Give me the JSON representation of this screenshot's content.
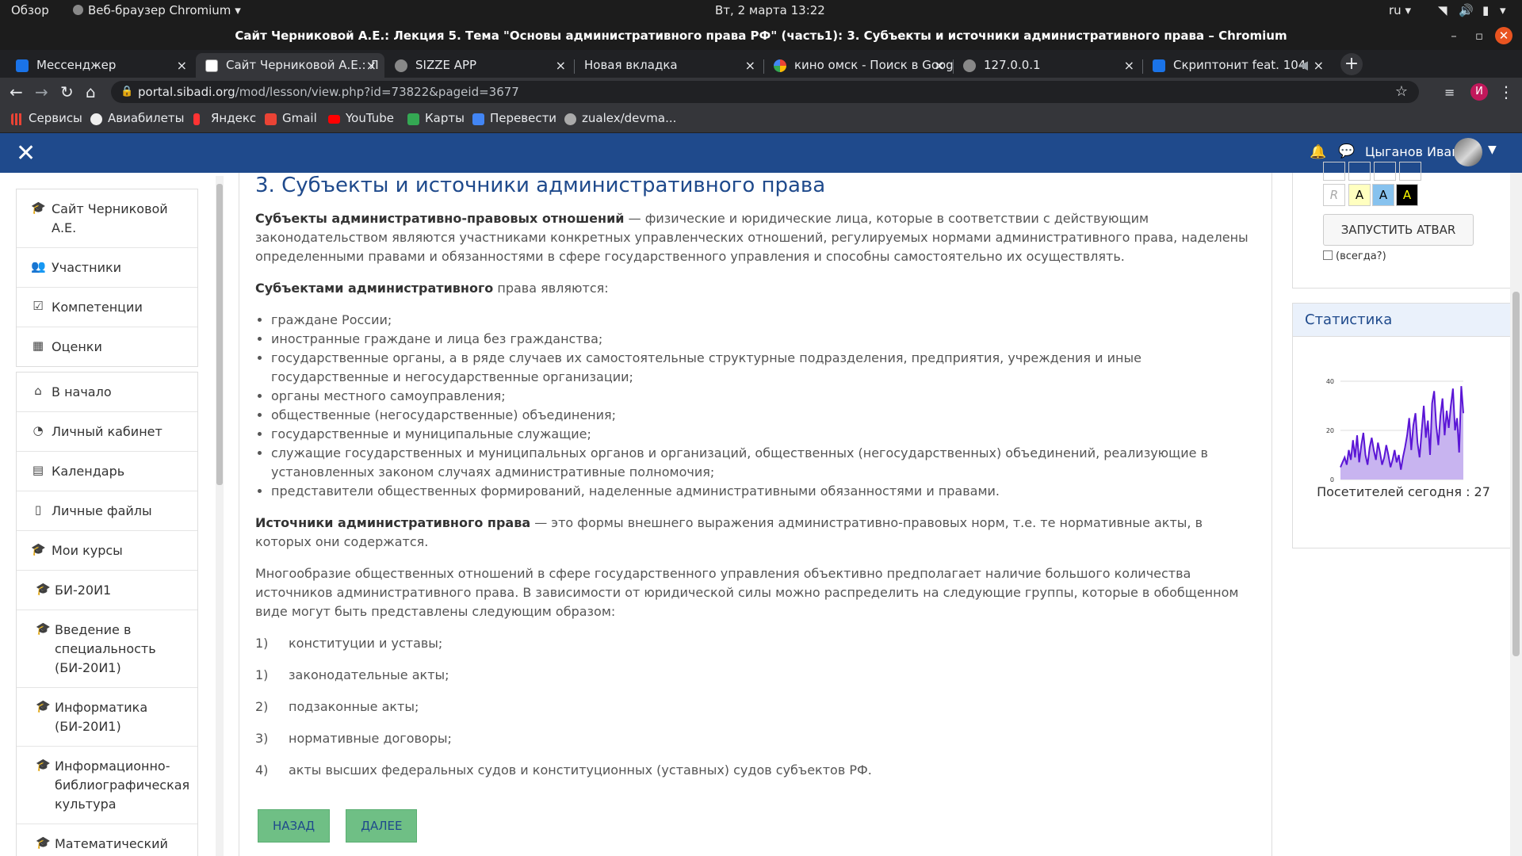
{
  "os_bar": {
    "overview": "Обзор",
    "app": "Веб-браузер Chromium",
    "clock": "Вт, 2 марта  13:22",
    "lang": "ru"
  },
  "window": {
    "title": "Сайт Черниковой А.Е.: Лекция 5. Тема \"Основы административного права РФ\" (часть1): 3. Субъекты и источники административного права – Chromium"
  },
  "tabs": [
    {
      "label": "Мессенджер",
      "color": "#1a73e8"
    },
    {
      "label": "Сайт Черниковой А.Е.: Л",
      "color": "#444"
    },
    {
      "label": "SIZZE APP",
      "color": "#888"
    },
    {
      "label": "Новая вкладка",
      "color": "#888"
    },
    {
      "label": "кино омск - Поиск в Goog",
      "color": "#4285f4"
    },
    {
      "label": "127.0.0.1",
      "color": "#888"
    },
    {
      "label": "Скриптонит feat. 104",
      "color": "#1a73e8"
    }
  ],
  "address": {
    "domain": "portal.sibadi.org",
    "path": "/mod/lesson/view.php?id=73822&pageid=3677"
  },
  "bookmarks": [
    {
      "label": "Сервисы",
      "color": "#ea4335"
    },
    {
      "label": "Авиабилеты",
      "color": "#eee"
    },
    {
      "label": "Яндекс",
      "color": "#f33"
    },
    {
      "label": "Gmail",
      "color": "#ea4335"
    },
    {
      "label": "YouTube",
      "color": "#f00"
    },
    {
      "label": "Карты",
      "color": "#34a853"
    },
    {
      "label": "Перевести",
      "color": "#4285f4"
    },
    {
      "label": "zualex/devma...",
      "color": "#aaa"
    }
  ],
  "header": {
    "user": "Цыганов Иван"
  },
  "sidebar": {
    "group1": [
      {
        "label": "Сайт Черниковой А.Е.",
        "icon": "graduation-cap-icon"
      },
      {
        "label": "Участники",
        "icon": "users-icon"
      },
      {
        "label": "Компетенции",
        "icon": "check-square-icon"
      },
      {
        "label": "Оценки",
        "icon": "table-icon"
      }
    ],
    "group2": [
      {
        "label": "В начало",
        "icon": "home-icon"
      },
      {
        "label": "Личный кабинет",
        "icon": "dashboard-icon"
      },
      {
        "label": "Календарь",
        "icon": "calendar-icon"
      },
      {
        "label": "Личные файлы",
        "icon": "file-icon"
      },
      {
        "label": "Мои курсы",
        "icon": "graduation-cap-icon"
      },
      {
        "label": "БИ-20И1",
        "icon": "graduation-cap-icon"
      },
      {
        "label": "Введение в специальность (БИ-20И1)",
        "icon": "graduation-cap-icon"
      },
      {
        "label": "Информатика (БИ-20И1)",
        "icon": "graduation-cap-icon"
      },
      {
        "label": "Информационно-библиографическая культура",
        "icon": "graduation-cap-icon"
      },
      {
        "label": "Математический анализ АСб, БИ",
        "icon": "graduation-cap-icon"
      }
    ]
  },
  "lesson": {
    "title": "3. Субъекты и источники административного права",
    "p1_bold": "Субъекты административно-правовых отношений",
    "p1_rest": " — физические и юридические лица, которые в соответствии с действующим законодательством являются участниками конкретных управленческих отношений, регулируемых нормами административного права, наделены определенными правами и обязанностями в сфере государственного управления и способны самостоятельно их осуществлять.",
    "p2_bold": "Субъектами административного",
    "p2_rest": " права являются:",
    "list": [
      "граждане России;",
      "иностранные граждане и лица без гражданства;",
      "государственные органы, а в ряде случаев их самостоятельные структурные подразделения, предприятия, учреждения и иные государственные и негосударственные организации;",
      "органы местного самоуправления;",
      "общественные (негосударственные) объединения;",
      "государственные и муниципальные служащие;",
      "служащие государственных и муниципальных органов и организаций, общественных (негосударственных) объединений, реализующие в установленных законом случаях административные полномочия;",
      "представители общественных формирований, наделенные административными обязанностями и правами."
    ],
    "p3_bold": "Источники административного права",
    "p3_rest": " — это формы внешнего выражения административно-правовых норм, т.е. те нормативные акты, в которых они содержатся.",
    "p4": "Многообразие общественных отношений в сфере государственного управления объективно предполагает наличие большого количества источников административного права. В зависимости от юридической силы можно распределить на следующие группы, которые в обобщенном виде могут быть представлены следующим образом:",
    "numbered": [
      {
        "n": "1)",
        "t": "конституции и уставы;"
      },
      {
        "n": "1)",
        "t": "законодательные акты;"
      },
      {
        "n": "2)",
        "t": "подзаконные акты;"
      },
      {
        "n": "3)",
        "t": "нормативные договоры;"
      },
      {
        "n": "4)",
        "t": "акты высших федеральных судов и конституционных (уставных) судов субъектов РФ."
      }
    ],
    "back": "НАЗАД",
    "next": "ДАЛЕЕ"
  },
  "atbar": {
    "buttons": [
      "R",
      "A",
      "A",
      "A"
    ],
    "start": "ЗАПУСТИТЬ ATBAR",
    "always": "(всегда?)"
  },
  "stats": {
    "title": "Статистика",
    "visitors": "Посетителей сегодня : 27"
  },
  "chart_data": {
    "type": "area",
    "title": "",
    "ylim": [
      0,
      40
    ],
    "yticks": [
      0,
      20,
      40
    ],
    "values": [
      5,
      7,
      9,
      6,
      12,
      8,
      16,
      9,
      18,
      7,
      14,
      19,
      10,
      6,
      13,
      17,
      12,
      8,
      15,
      11,
      6,
      9,
      14,
      10,
      5,
      8,
      12,
      7,
      10,
      4,
      9,
      13,
      18,
      25,
      12,
      22,
      27,
      15,
      9,
      20,
      30,
      17,
      24,
      10,
      31,
      36,
      22,
      14,
      26,
      33,
      18,
      28,
      21,
      30,
      37,
      20,
      25,
      11,
      38,
      27
    ]
  }
}
